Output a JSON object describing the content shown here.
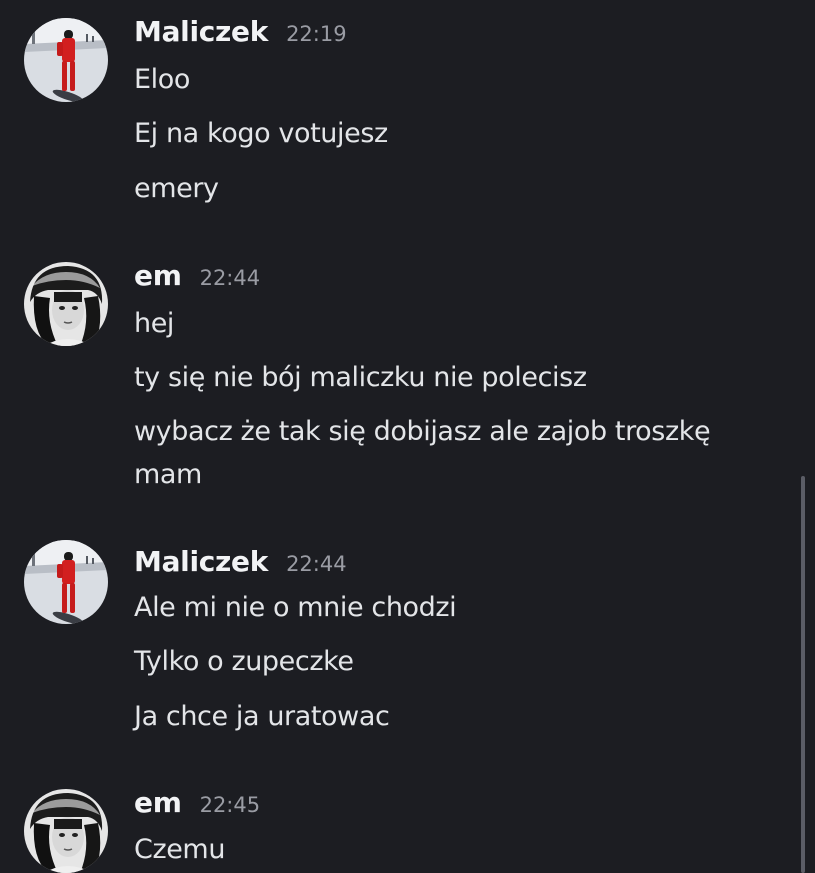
{
  "messages": [
    {
      "user": "Maliczek",
      "time": "22:19",
      "avatar": "snowboarder-avatar",
      "lines": [
        "Eloo",
        "Ej na kogo votujesz",
        "emery"
      ]
    },
    {
      "user": "em",
      "time": "22:44",
      "avatar": "bw-portrait-avatar",
      "lines": [
        "hej",
        "ty się nie bój maliczku nie polecisz",
        "wybacz że tak się dobijasz ale zajob troszkę",
        "mam"
      ]
    },
    {
      "user": "Maliczek",
      "time": "22:44",
      "avatar": "snowboarder-avatar",
      "lines": [
        "Ale mi nie o mnie chodzi",
        "Tylko o zupeczke",
        "Ja chce ja uratowac"
      ]
    },
    {
      "user": "em",
      "time": "22:45",
      "avatar": "bw-portrait-avatar",
      "lines": [
        "Czemu"
      ]
    }
  ],
  "colors": {
    "background": "#1c1d22",
    "username": "#f2f3f5",
    "timestamp": "#9a9ca4",
    "text": "#e3e5e8",
    "scrollbar": "#5b5d66"
  }
}
